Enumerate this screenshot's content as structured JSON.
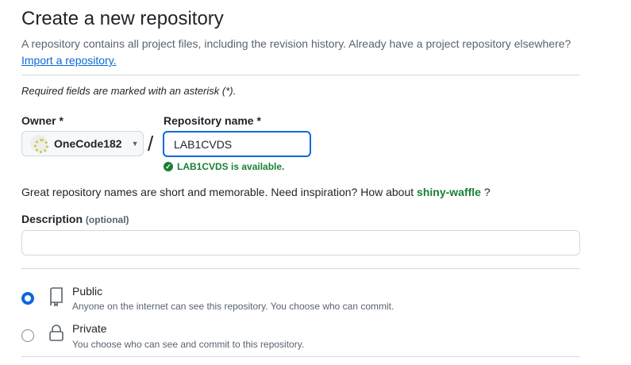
{
  "title": "Create a new repository",
  "subtitle": "A repository contains all project files, including the revision history. Already have a project repository elsewhere?",
  "import_link": "Import a repository.",
  "required_note": "Required fields are marked with an asterisk (*).",
  "owner": {
    "label": "Owner *",
    "value": "OneCode182"
  },
  "separator": "/",
  "repo_name": {
    "label": "Repository name *",
    "value": "LAB1CVDS",
    "availability": "LAB1CVDS is available."
  },
  "suggestion": {
    "text": "Great repository names are short and memorable. Need inspiration? How about",
    "name": "shiny-waffle",
    "suffix": " ?"
  },
  "description": {
    "label": "Description",
    "optional": "(optional)",
    "value": ""
  },
  "visibility": [
    {
      "label": "Public",
      "desc": "Anyone on the internet can see this repository. You choose who can commit.",
      "selected": true,
      "icon": "repo-icon"
    },
    {
      "label": "Private",
      "desc": "You choose who can see and commit to this repository.",
      "selected": false,
      "icon": "lock-icon"
    }
  ],
  "colors": {
    "accent": "#0969da",
    "success": "#1a7f37"
  }
}
